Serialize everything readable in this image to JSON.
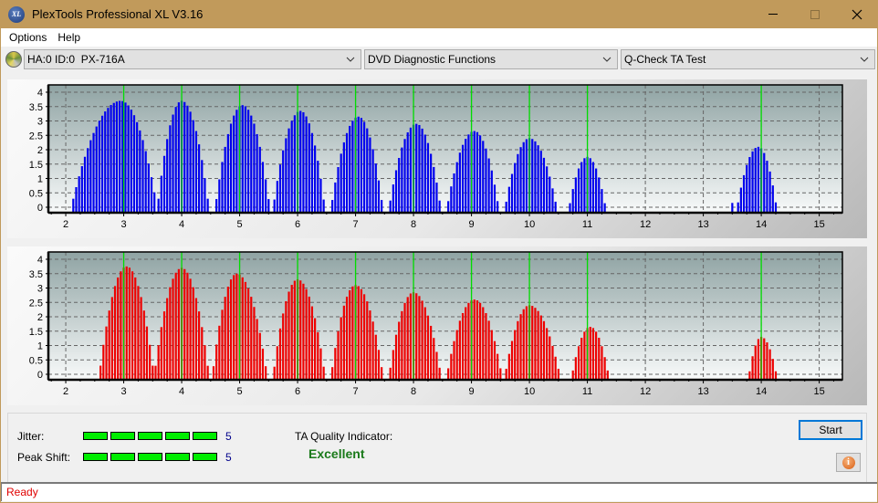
{
  "window": {
    "title": "PlexTools Professional XL V3.16",
    "icon": "plextools-xl-icon",
    "controls": [
      "minimize",
      "maximize",
      "close"
    ]
  },
  "menu": [
    {
      "label": "Options"
    },
    {
      "label": "Help"
    }
  ],
  "toolbar": {
    "drive_select": "HA:0 ID:0  PX-716A",
    "function_select": "DVD Diagnostic Functions",
    "test_select": "Q-Check TA Test"
  },
  "colors": {
    "titlebar": "#c19a5b",
    "upper_bars": "#0000ee",
    "lower_bars": "#ee0000",
    "marker_lines": "#00dd00",
    "led_on": "#00ee00",
    "status_text": "#e00000",
    "quality_text": "#1a7a1a"
  },
  "chart_data": [
    {
      "name": "upper-chart",
      "type": "bar",
      "series_color": "blue",
      "xlim": [
        1.7,
        15.4
      ],
      "ylim": [
        0,
        4
      ],
      "x_ticks": [
        2,
        3,
        4,
        5,
        6,
        7,
        8,
        9,
        10,
        11,
        12,
        13,
        14,
        15
      ],
      "y_ticks": [
        "0",
        "0.5",
        "1",
        "1.5",
        "2",
        "2.5",
        "3",
        "3.5",
        "4"
      ],
      "grid": true,
      "markers": [
        3,
        4,
        5,
        6,
        7,
        8,
        9,
        10,
        11,
        14
      ],
      "peaks": [
        {
          "center": 2.95,
          "peak": 3.7,
          "start": 2.13,
          "end": 3.55
        },
        {
          "center": 4.0,
          "peak": 3.7,
          "start": 3.6,
          "end": 4.45
        },
        {
          "center": 5.05,
          "peak": 3.55,
          "start": 4.6,
          "end": 5.5
        },
        {
          "center": 6.05,
          "peak": 3.35,
          "start": 5.6,
          "end": 6.45
        },
        {
          "center": 7.05,
          "peak": 3.15,
          "start": 6.6,
          "end": 7.45
        },
        {
          "center": 8.05,
          "peak": 2.9,
          "start": 7.6,
          "end": 8.45
        },
        {
          "center": 9.05,
          "peak": 2.65,
          "start": 8.6,
          "end": 9.45
        },
        {
          "center": 10.0,
          "peak": 2.4,
          "start": 9.6,
          "end": 10.45
        },
        {
          "center": 11.0,
          "peak": 1.75,
          "start": 10.7,
          "end": 11.3
        },
        {
          "center": 13.95,
          "peak": 2.1,
          "start": 13.6,
          "end": 14.25
        }
      ],
      "isolated": [
        {
          "x": 13.5,
          "y": 0.15
        }
      ]
    },
    {
      "name": "lower-chart",
      "type": "bar",
      "series_color": "red",
      "xlim": [
        1.7,
        15.4
      ],
      "ylim": [
        0,
        4
      ],
      "x_ticks": [
        2,
        3,
        4,
        5,
        6,
        7,
        8,
        9,
        10,
        11,
        12,
        13,
        14,
        15
      ],
      "y_ticks": [
        "0",
        "0.5",
        "1",
        "1.5",
        "2",
        "2.5",
        "3",
        "3.5",
        "4"
      ],
      "grid": true,
      "markers": [
        3,
        4,
        5,
        6,
        7,
        8,
        9,
        10,
        11,
        14
      ],
      "peaks": [
        {
          "center": 3.05,
          "peak": 3.75,
          "start": 2.6,
          "end": 3.5
        },
        {
          "center": 4.0,
          "peak": 3.7,
          "start": 3.55,
          "end": 4.45
        },
        {
          "center": 4.95,
          "peak": 3.5,
          "start": 4.55,
          "end": 5.45
        },
        {
          "center": 6.0,
          "peak": 3.3,
          "start": 5.6,
          "end": 6.45
        },
        {
          "center": 7.0,
          "peak": 3.1,
          "start": 6.6,
          "end": 7.45
        },
        {
          "center": 8.0,
          "peak": 2.85,
          "start": 7.6,
          "end": 8.45
        },
        {
          "center": 9.05,
          "peak": 2.6,
          "start": 8.6,
          "end": 9.5
        },
        {
          "center": 10.0,
          "peak": 2.4,
          "start": 9.6,
          "end": 10.5
        },
        {
          "center": 11.05,
          "peak": 1.65,
          "start": 10.75,
          "end": 11.35
        },
        {
          "center": 14.0,
          "peak": 1.3,
          "start": 13.8,
          "end": 14.25
        }
      ],
      "isolated": []
    }
  ],
  "metrics": {
    "jitter": {
      "label": "Jitter:",
      "value": "5",
      "level": 5,
      "max": 5
    },
    "peak_shift": {
      "label": "Peak Shift:",
      "value": "5",
      "level": 5,
      "max": 5
    }
  },
  "ta_quality": {
    "label": "TA Quality Indicator:",
    "value": "Excellent"
  },
  "buttons": {
    "start": "Start",
    "info": "i"
  },
  "status": "Ready"
}
